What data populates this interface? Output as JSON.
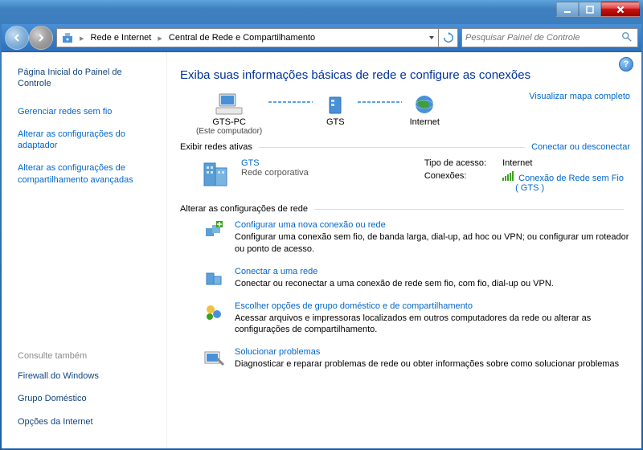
{
  "breadcrumb": {
    "seg1": "Rede e Internet",
    "seg2": "Central de Rede e Compartilhamento"
  },
  "search": {
    "placeholder": "Pesquisar Painel de Controle"
  },
  "sidebar": {
    "home": "Página Inicial do Painel de Controle",
    "links": [
      "Gerenciar redes sem fio",
      "Alterar as configurações do adaptador",
      "Alterar as configurações de compartilhamento avançadas"
    ],
    "footer_head": "Consulte também",
    "footer_links": [
      "Firewall do Windows",
      "Grupo Doméstico",
      "Opções da Internet"
    ]
  },
  "main": {
    "title": "Exiba suas informações básicas de rede e configure as conexões",
    "map_link": "Visualizar mapa completo",
    "nodes": {
      "pc": "GTS-PC",
      "pc_sub": "(Este computador)",
      "gw": "GTS",
      "net": "Internet"
    },
    "active": {
      "section": "Exibir redes ativas",
      "section_link": "Conectar ou desconectar",
      "name": "GTS",
      "type": "Rede corporativa",
      "access_label": "Tipo de acesso:",
      "access_value": "Internet",
      "conn_label": "Conexões:",
      "conn_value": "Conexão de Rede sem Fio",
      "conn_paren": "( GTS )"
    },
    "change_section": "Alterar as configurações de rede",
    "tasks": [
      {
        "title": "Configurar uma nova conexão ou rede",
        "desc": "Configurar uma conexão sem fio, de banda larga, dial-up, ad hoc ou VPN; ou configurar um roteador ou ponto de acesso."
      },
      {
        "title": "Conectar a uma rede",
        "desc": "Conectar ou reconectar a uma conexão de rede sem fio, com fio, dial-up ou VPN."
      },
      {
        "title": "Escolher opções de grupo doméstico e de compartilhamento",
        "desc": "Acessar arquivos e impressoras localizados em outros computadores da rede ou alterar as configurações de compartilhamento."
      },
      {
        "title": "Solucionar problemas",
        "desc": "Diagnosticar e reparar problemas de rede ou obter informações sobre como solucionar problemas"
      }
    ]
  }
}
